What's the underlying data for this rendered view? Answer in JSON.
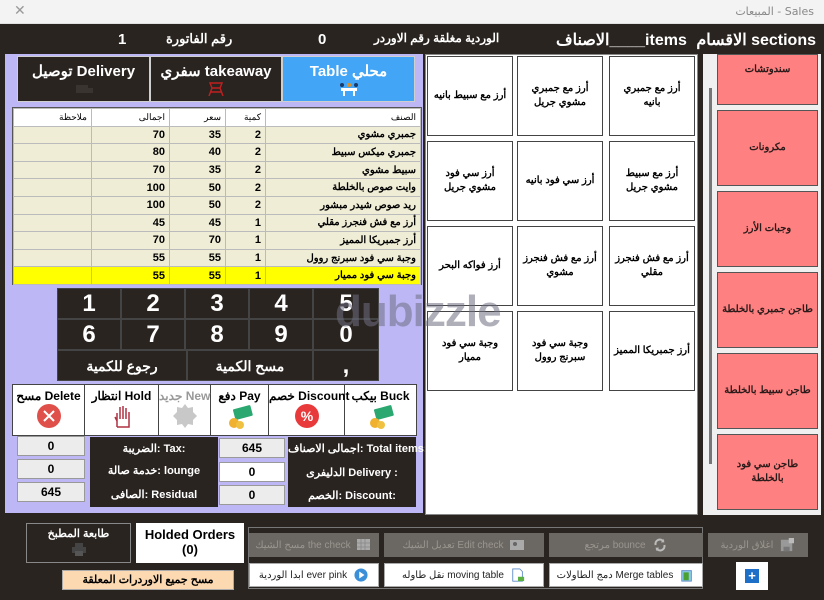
{
  "window": {
    "title": "المبيعات - Sales",
    "close_icon": "close-icon"
  },
  "header": {
    "sections_label": "الاقسام sections",
    "items_label": "الاصناف____items",
    "shift_status": "الوردية مغلقة رقم الاوردر",
    "order_number": "0",
    "invoice_label": "رقم الفاتورة",
    "invoice_number": "1"
  },
  "order_types": [
    {
      "label": "Table محلي",
      "icon": "dine-in-table-icon",
      "active": true
    },
    {
      "label": "سفري takeaway",
      "icon": "takeaway-chair-icon",
      "active": false
    },
    {
      "label": "توصيل Delivery",
      "icon": "delivery-truck-icon",
      "active": false
    }
  ],
  "order_grid": {
    "columns": [
      "الصنف",
      "كمية",
      "سعر",
      "اجمالى",
      "ملاحظة"
    ],
    "rows": [
      {
        "item": "جمبري مشوي",
        "qty": "2",
        "price": "35",
        "total": "70",
        "note": ""
      },
      {
        "item": "جمبري ميكس سبيط",
        "qty": "2",
        "price": "40",
        "total": "80",
        "note": ""
      },
      {
        "item": "سبيط مشوي",
        "qty": "2",
        "price": "35",
        "total": "70",
        "note": ""
      },
      {
        "item": "وايت صوص بالخلطة",
        "qty": "2",
        "price": "50",
        "total": "100",
        "note": ""
      },
      {
        "item": "ريد صوص شيدر مبشور",
        "qty": "2",
        "price": "50",
        "total": "100",
        "note": ""
      },
      {
        "item": "أرز مع فش فنجرز مقلي",
        "qty": "1",
        "price": "45",
        "total": "45",
        "note": ""
      },
      {
        "item": "أرز جمبريكا المميز",
        "qty": "1",
        "price": "70",
        "total": "70",
        "note": ""
      },
      {
        "item": "وجبة سي فود سبرنج روول",
        "qty": "1",
        "price": "55",
        "total": "55",
        "note": ""
      },
      {
        "item": "وجبة سي فود مميار",
        "qty": "1",
        "price": "55",
        "total": "55",
        "note": "",
        "selected": true
      }
    ]
  },
  "numpad": {
    "row1": [
      "1",
      "2",
      "3",
      "4",
      "5"
    ],
    "row2": [
      "6",
      "7",
      "8",
      "9",
      "0"
    ],
    "back_qty": "رجوع للكمية",
    "clear_qty": "مسح الكمية",
    "comma": ","
  },
  "actions": [
    {
      "label": "مسح Delete",
      "icon": "delete-x-icon"
    },
    {
      "label": "انتظار Hold",
      "icon": "hand-stop-icon"
    },
    {
      "label": "جديد New",
      "icon": "new-badge-icon"
    },
    {
      "label": "دفع Pay",
      "icon": "money-icon"
    },
    {
      "label": "خصم Discount",
      "icon": "percent-icon"
    },
    {
      "label": "بيكب Buck",
      "icon": "money-back-icon"
    }
  ],
  "summary": {
    "total_items_label": "اجمالى الاصناف: Total items:",
    "total_items_value": "645",
    "delivery_label": "الدليفرى    Delivery :",
    "delivery_value": "0",
    "discount_label": "الخصم:  Discount:",
    "discount_value": "0",
    "tax_label": "الضريبة:    Tax:",
    "tax_value": "0",
    "lounge_label": "خدمة صالة:  lounge",
    "lounge_value": "0",
    "residual_label": "الصافى:    Residual",
    "residual_value": "645"
  },
  "items": [
    "أرز مع جمبري بانيه",
    "أرز مع جمبري مشوي جريل",
    "أرز مع سبيط بانيه",
    "أرز مع سبيط مشوي جريل",
    "أرز سي فود بانيه",
    "أرز سي فود مشوي جريل",
    "أرز مع فش فنجرز مقلي",
    "أرز مع فش فنجرز مشوي",
    "أرز فواكه البحر",
    "أرز جمبريكا المميز",
    "وجبة سي فود سبرنج روول",
    "وجبة سي فود مميار"
  ],
  "sections": [
    "سندوتشات",
    "مكرونات",
    "وجبات الأرز",
    "طاجن جمبري بالخلطة",
    "طاجن سبيط بالخلطة",
    "طاجن سي فود بالخلطة"
  ],
  "bottom": {
    "kitchen_printer": "طابعة المطبخ",
    "held_orders_title": "Holded Orders",
    "held_orders_count": "(0)",
    "clear_held": "مسح جميع الاوردرات المعلقة",
    "clear_check": "مسح الشيك the check",
    "edit_check": "تعديل الشيك Edit check",
    "bounce": "مرتجع  bounce",
    "close_shift": "اغلاق الوردية",
    "start_shift": "ابدا الوردية ever pink",
    "moving_table": "نقل طاوله moving table",
    "merge_tables": "دمج الطاولات Merge tables",
    "plus": "+"
  },
  "watermark": "dubizzle",
  "colors": {
    "dark_bg": "#2a2420",
    "panel_lavender": "#bdb8f5",
    "active_tab": "#42a5f5",
    "section_pink": "#ff8080",
    "selected_row": "#ffff00",
    "row_bg": "#efedd6",
    "clear_held_bg": "#fcd9b0"
  }
}
